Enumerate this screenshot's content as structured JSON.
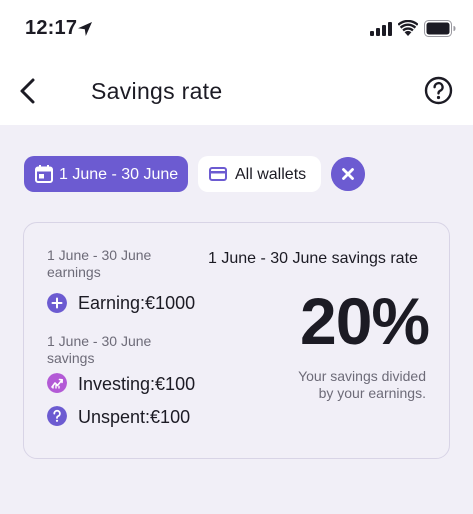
{
  "status_bar": {
    "time": "12:17"
  },
  "header": {
    "title": "Savings rate"
  },
  "filters": {
    "date_range": "1 June - 30 June",
    "wallet": "All wallets"
  },
  "card": {
    "earnings_caption": "1 June - 30 June earnings",
    "earning_label": "Earning:",
    "earning_value": "€1000",
    "savings_caption": "1 June - 30 June savings",
    "investing_label": "Investing:",
    "investing_value": "€100",
    "unspent_label": "Unspent:",
    "unspent_value": "€100",
    "rate_title": "1 June - 30 June savings rate",
    "rate_value": "20%",
    "rate_desc_line1": "Your savings divided",
    "rate_desc_line2": "by your earnings."
  },
  "colors": {
    "accent": "#6c5bd1",
    "investing": "#b35ad6",
    "background": "#f1eff7"
  }
}
